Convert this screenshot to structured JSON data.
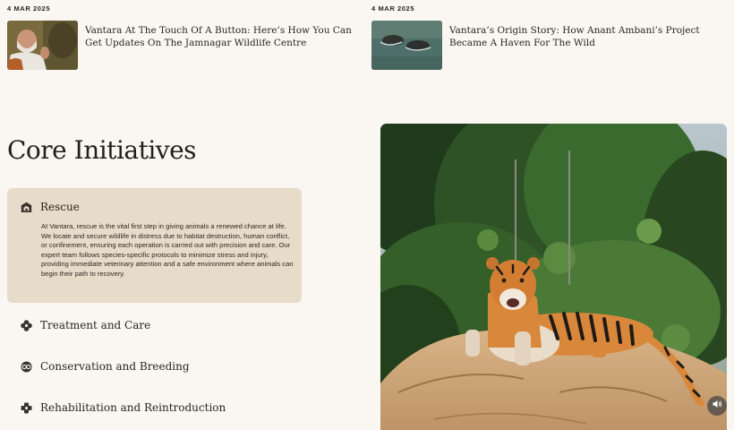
{
  "news": [
    {
      "date": "4 MAR 2025",
      "title": "Vantara At The Touch Of A Button: Here’s How You Can Get Updates On The Jamnagar Wildlife Centre",
      "thumb_icon": "person-photo-thumbnail"
    },
    {
      "date": "4 MAR 2025",
      "title": "Vantara’s Origin Story: How Anant Ambani’s Project Became A Haven For The Wild",
      "thumb_icon": "rhinos-in-water-thumbnail"
    }
  ],
  "section": {
    "heading": "Core Initiatives"
  },
  "initiatives": [
    {
      "label": "Rescue",
      "icon": "shelter-icon",
      "expanded": true,
      "body": "At Vantara, rescue is the vital first step in giving animals a renewed chance at life. We locate and secure wildlife in distress due to habitat destruction, human conflict, or confinement, ensuring each operation is carried out with precision and care. Our expert team follows species-specific protocols to minimize stress and injury, providing immediate veterinary attention and a safe environment where animals can begin their path to recovery."
    },
    {
      "label": "Treatment and Care",
      "icon": "flower-icon",
      "expanded": false
    },
    {
      "label": "Conservation and Breeding",
      "icon": "circles-icon",
      "expanded": false
    },
    {
      "label": "Rehabilitation and Reintroduction",
      "icon": "cross-leaf-icon",
      "expanded": false
    }
  ],
  "hero": {
    "image_icon": "tiger-on-rock-image",
    "sound_icon": "speaker-icon"
  },
  "colors": {
    "background": "#faf7f3",
    "accent_panel": "#e7dbc9",
    "text": "#2a241f"
  }
}
